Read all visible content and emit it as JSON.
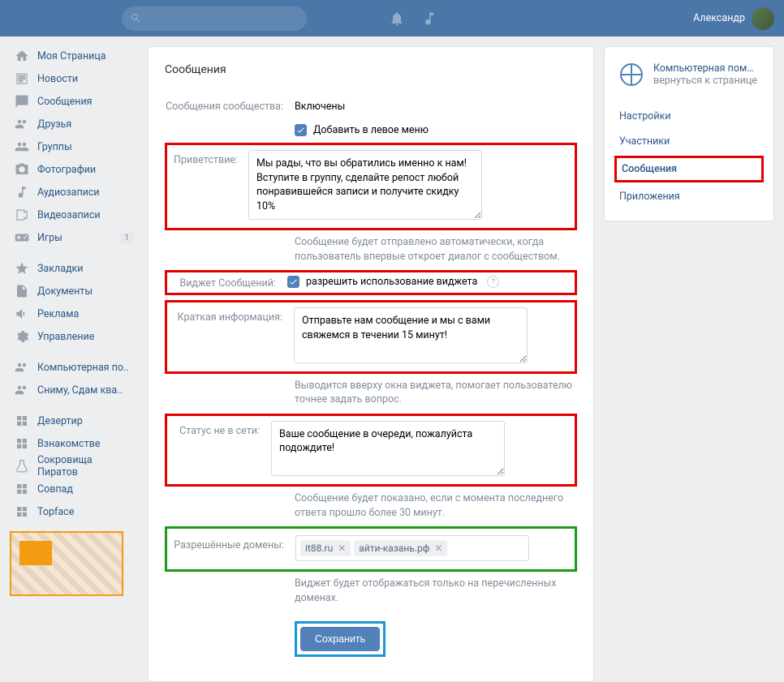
{
  "header": {
    "username": "Александр"
  },
  "sidebar": {
    "items": [
      {
        "label": "Моя Страница",
        "icon": "home"
      },
      {
        "label": "Новости",
        "icon": "news"
      },
      {
        "label": "Сообщения",
        "icon": "msg"
      },
      {
        "label": "Друзья",
        "icon": "friends"
      },
      {
        "label": "Группы",
        "icon": "groups"
      },
      {
        "label": "Фотографии",
        "icon": "photo"
      },
      {
        "label": "Аудиозаписи",
        "icon": "audio"
      },
      {
        "label": "Видеозаписи",
        "icon": "video"
      },
      {
        "label": "Игры",
        "icon": "games",
        "badge": "1"
      }
    ],
    "items2": [
      {
        "label": "Закладки",
        "icon": "star"
      },
      {
        "label": "Документы",
        "icon": "docs"
      },
      {
        "label": "Реклама",
        "icon": "ad"
      },
      {
        "label": "Управление",
        "icon": "gear"
      }
    ],
    "items3": [
      {
        "label": "Компьютерная по..",
        "icon": "people"
      },
      {
        "label": "Сниму, Сдам ква..",
        "icon": "people"
      }
    ],
    "items4": [
      {
        "label": "Дезертир",
        "icon": "app"
      },
      {
        "label": "Взнакомстве",
        "icon": "app"
      },
      {
        "label": "Сокровища Пиратов",
        "icon": "flask"
      },
      {
        "label": "Совпад",
        "icon": "app"
      },
      {
        "label": "Topface",
        "icon": "app"
      }
    ]
  },
  "content": {
    "title": "Сообщения",
    "status_label": "Сообщения сообщества:",
    "status_value": "Включены",
    "add_menu": "Добавить в левое меню",
    "greeting_label": "Приветствие:",
    "greeting_value": "Мы рады, что вы обратились именно к нам! Вступите в группу, сделайте репост любой понравившейся записи и получите скидку 10%",
    "greeting_hint": "Сообщение будет отправлено автоматически, когда пользователь впервые откроет диалог с сообществом.",
    "widget_label": "Виджет Сообщений:",
    "widget_check": "разрешить использование виджета",
    "brief_label": "Краткая информация:",
    "brief_value": "Отправьте нам сообщение и мы с вами свяжемся в течении 15 минут!",
    "brief_hint": "Выводится вверху окна виджета, помогает пользователю точнее задать вопрос.",
    "offline_label": "Статус не в сети:",
    "offline_value": "Ваше сообщение в очереди, пожалуйста подождите!",
    "offline_hint": "Сообщение будет показано, если с момента последнего ответа прошло более 30 минут.",
    "domains_label": "Разрешённые домены:",
    "domains": [
      "it88.ru",
      "айти-казань.рф"
    ],
    "domains_hint": "Виджет будет отображаться только на перечисленных доменах.",
    "save": "Сохранить"
  },
  "rightbox": {
    "title": "Компьютерная помощь ...",
    "back": "вернуться к странице",
    "tabs": [
      "Настройки",
      "Участники",
      "Сообщения",
      "Приложения"
    ]
  }
}
